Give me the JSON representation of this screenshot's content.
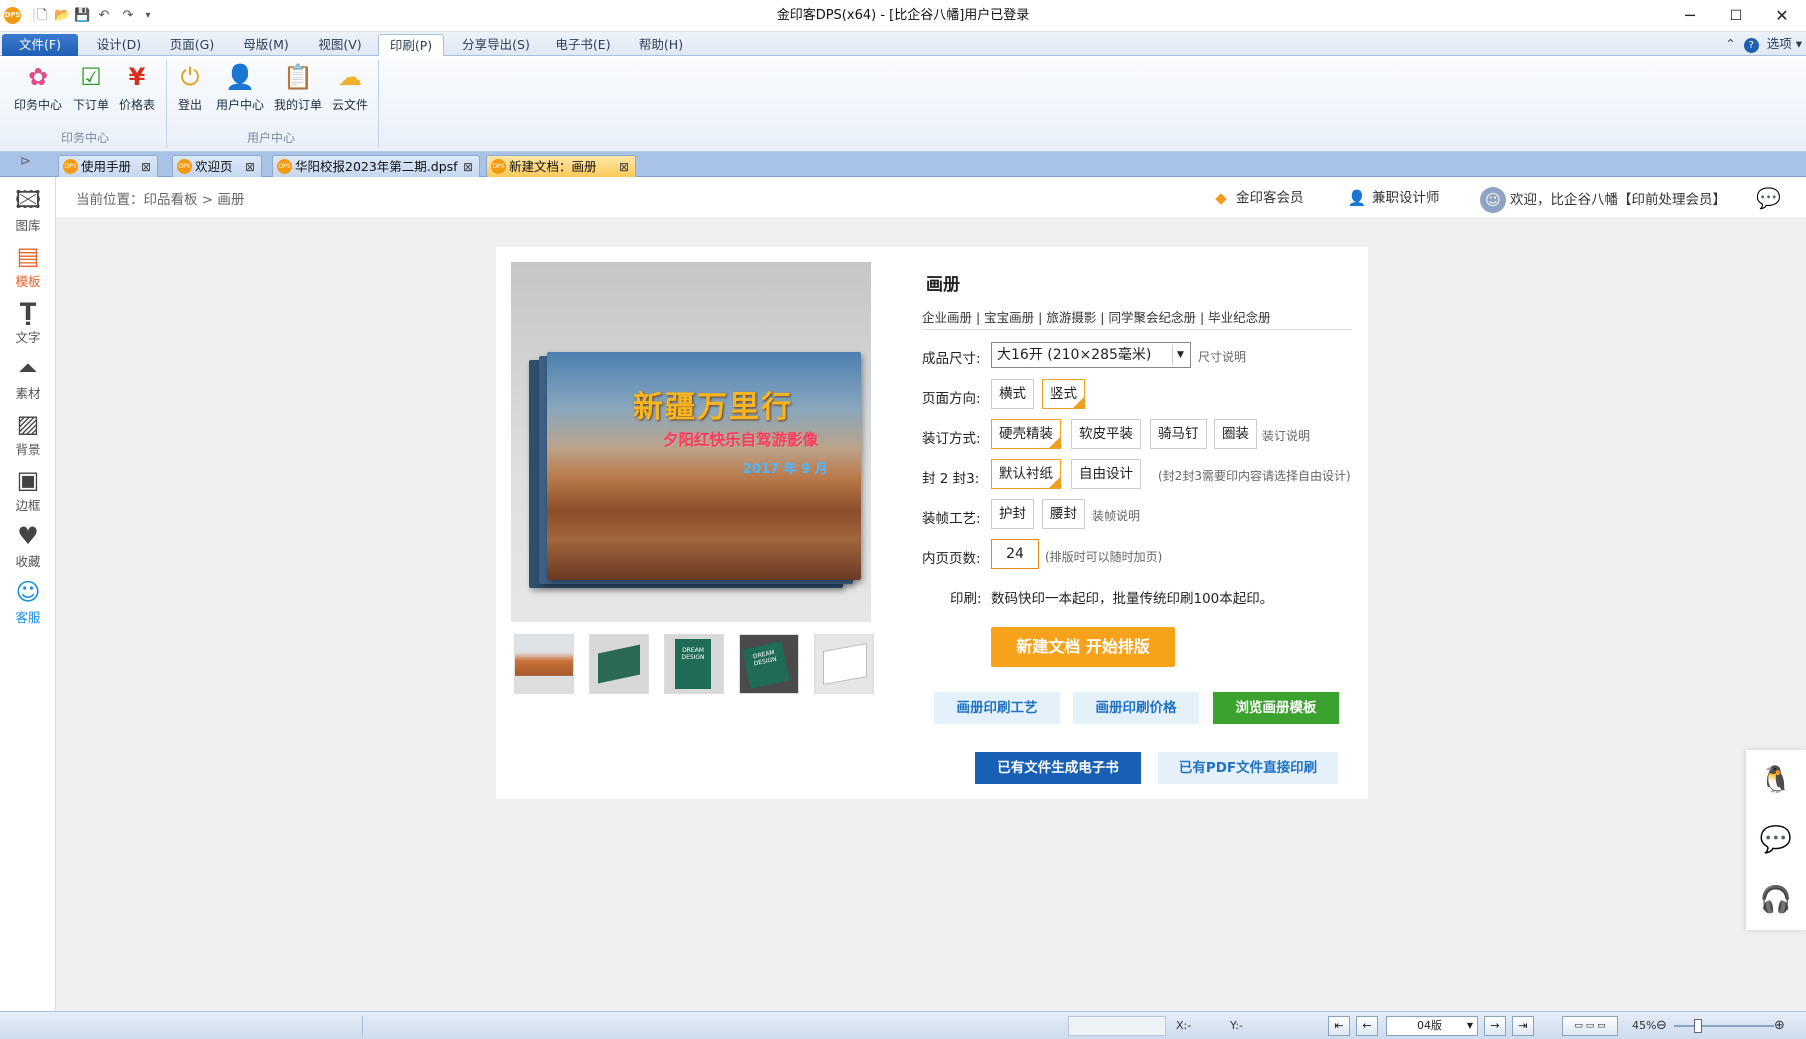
{
  "window": {
    "title": "金印客DPS(x64) - [比企谷八幡]用户已登录",
    "logo": "DPS"
  },
  "menu": [
    "文件(F)",
    "设计(D)",
    "页面(G)",
    "母版(M)",
    "视图(V)",
    "印刷(P)",
    "分享导出(S)",
    "电子书(E)",
    "帮助(H)"
  ],
  "menu_right": "选项",
  "ribbon": {
    "buttons": [
      "印务中心",
      "下订单",
      "价格表",
      "登出",
      "用户中心",
      "我的订单",
      "云文件"
    ],
    "groups": [
      "印务中心",
      "用户中心"
    ]
  },
  "tabs": [
    "使用手册",
    "欢迎页",
    "华阳校报2023年第二期.dpsf",
    "新建文档：画册"
  ],
  "sidebar": [
    "图库",
    "模板",
    "文字",
    "素材",
    "背景",
    "边框",
    "收藏",
    "客服"
  ],
  "breadcrumb": "当前位置：印品看板 > 画册",
  "header": {
    "member": "金印客会员",
    "designer": "兼职设计师",
    "welcome": "欢迎，比企谷八幡【印前处理会员】"
  },
  "cover": {
    "title": "新疆万里行",
    "subtitle": "夕阳红快乐自驾游影像",
    "date": "2017 年 9 月"
  },
  "product": {
    "title": "画册",
    "categories": "企业画册 | 宝宝画册 | 旅游摄影 | 同学聚会纪念册 | 毕业纪念册",
    "size_label": "成品尺寸:",
    "size_value": "大16开 (210×285毫米)",
    "size_note": "尺寸说明",
    "orient_label": "页面方向:",
    "orient_options": [
      "横式",
      "竖式"
    ],
    "binding_label": "装订方式:",
    "binding_options": [
      "硬壳精装",
      "软皮平装",
      "骑马钉",
      "圈装"
    ],
    "binding_note": "装订说明",
    "cover23_label": "封 2 封3:",
    "cover23_options": [
      "默认衬纸",
      "自由设计"
    ],
    "cover23_note": "(封2封3需要印内容请选择自由设计)",
    "craft_label": "装帧工艺:",
    "craft_options": [
      "护封",
      "腰封"
    ],
    "craft_note": "装帧说明",
    "pages_label": "内页页数:",
    "pages_value": "24",
    "pages_note": "(排版时可以随时加页)",
    "print_label": "印刷:",
    "print_text": "数码快印一本起印，批量传统印刷100本起印。",
    "cta": "新建文档 开始排版",
    "links": [
      "画册印刷工艺",
      "画册印刷价格",
      "浏览画册模板"
    ],
    "bottom_buttons": [
      "已有文件生成电子书",
      "已有PDF文件直接印刷"
    ]
  },
  "thumbs": {
    "dream1": "DREAM DESIGN",
    "dream2": "DREAM DESIGN"
  },
  "status": {
    "x": "X:-",
    "y": "Y:-",
    "page": "04版",
    "zoom": "45%"
  }
}
